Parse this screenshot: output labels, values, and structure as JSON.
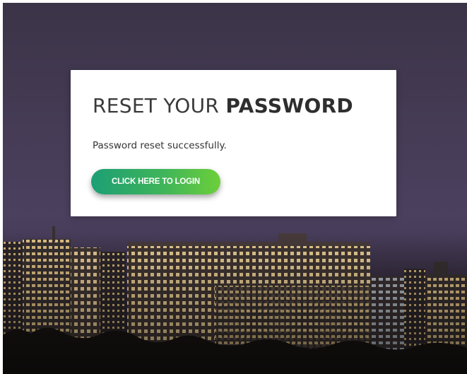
{
  "card": {
    "title_light": "RESET YOUR ",
    "title_bold": "PASSWORD",
    "message": "Password reset successfully.",
    "login_button_label": "CLICK HERE TO LOGIN"
  },
  "colors": {
    "button_gradient_start": "#1c9f75",
    "button_gradient_end": "#6ccf3a",
    "background_sky": "#463c56"
  }
}
